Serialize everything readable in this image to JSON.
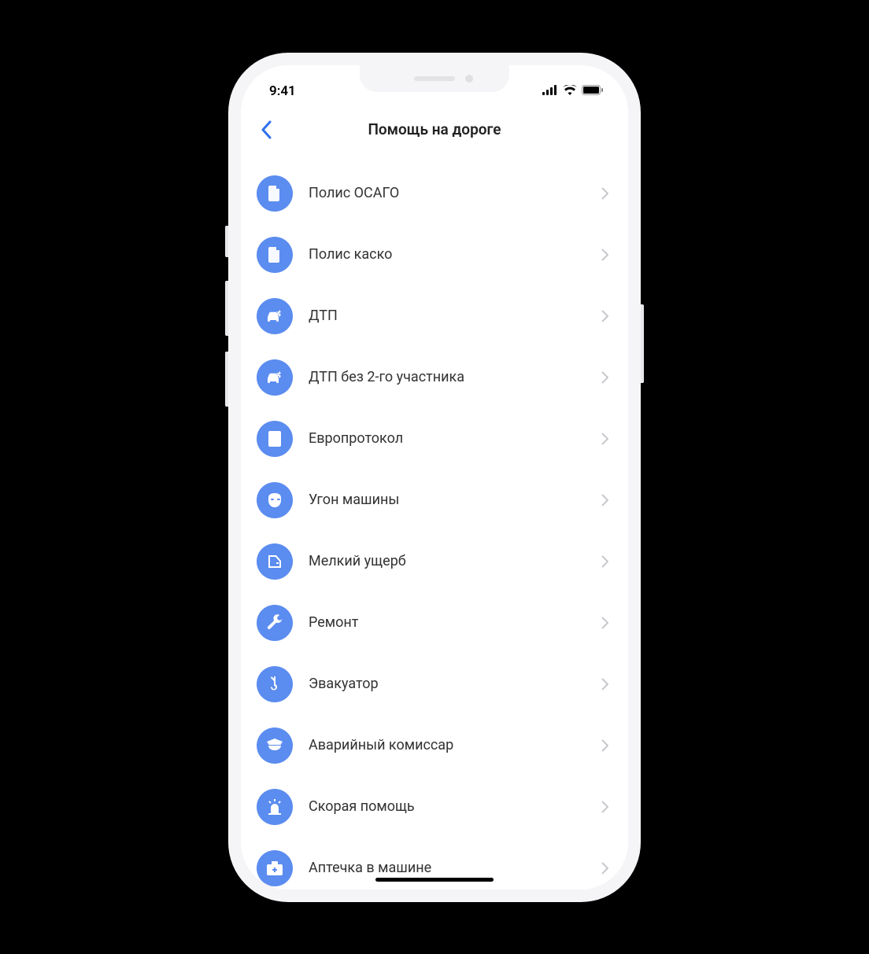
{
  "status": {
    "time": "9:41"
  },
  "nav": {
    "title": "Помощь на дороге"
  },
  "list": {
    "items": [
      {
        "icon": "document-shield-icon",
        "label": "Полис ОСАГО"
      },
      {
        "icon": "document-shield-icon",
        "label": "Полис каско"
      },
      {
        "icon": "car-crash-icon",
        "label": "ДТП"
      },
      {
        "icon": "car-crash-icon",
        "label": "ДТП без 2-го участника"
      },
      {
        "icon": "form-icon",
        "label": "Европротокол"
      },
      {
        "icon": "mask-icon",
        "label": "Угон машины"
      },
      {
        "icon": "car-door-icon",
        "label": "Мелкий ущерб"
      },
      {
        "icon": "wrench-icon",
        "label": "Ремонт"
      },
      {
        "icon": "tow-hook-icon",
        "label": "Эвакуатор"
      },
      {
        "icon": "police-cap-icon",
        "label": "Аварийный комиссар"
      },
      {
        "icon": "siren-icon",
        "label": "Скорая помощь"
      },
      {
        "icon": "first-aid-icon",
        "label": "Аптечка в машине"
      }
    ]
  }
}
